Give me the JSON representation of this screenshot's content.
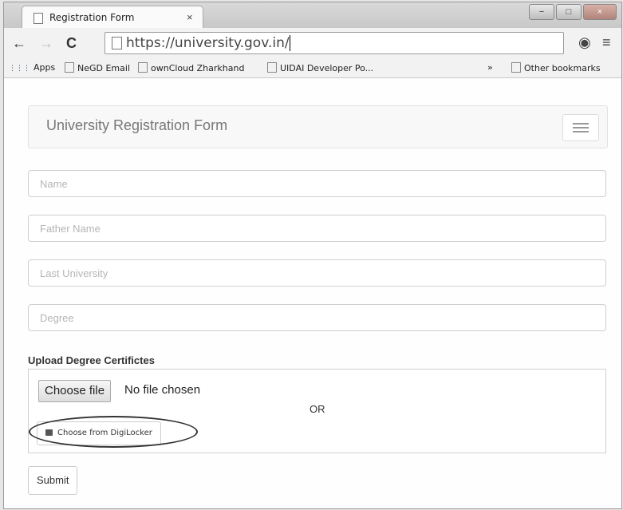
{
  "browser": {
    "tab_title": "Registration Form",
    "tab_close": "×",
    "url": "https://university.gov.in/",
    "bookmarks": [
      "Apps",
      "NeGD Email",
      "ownCloud Zharkhand",
      "UIDAI Developer Po...",
      "»",
      "Other bookmarks"
    ]
  },
  "form": {
    "brand": "University Registration Form",
    "fields": [
      {
        "placeholder": "Name"
      },
      {
        "placeholder": "Father Name"
      },
      {
        "placeholder": "Last University"
      },
      {
        "placeholder": "Degree"
      }
    ],
    "upload_label": "Upload Degree Certifictes",
    "choose_file": "Choose file",
    "no_file": "No file chosen",
    "or": "OR",
    "digilocker": "Choose from DigiLocker",
    "submit": "Submit"
  },
  "icons": {
    "back": "←",
    "forward": "→",
    "reload": "C",
    "menu": "≡",
    "globe": "◉",
    "apps": "⋮⋮⋮",
    "minimize": "−",
    "maximize": "□",
    "close": "×"
  }
}
